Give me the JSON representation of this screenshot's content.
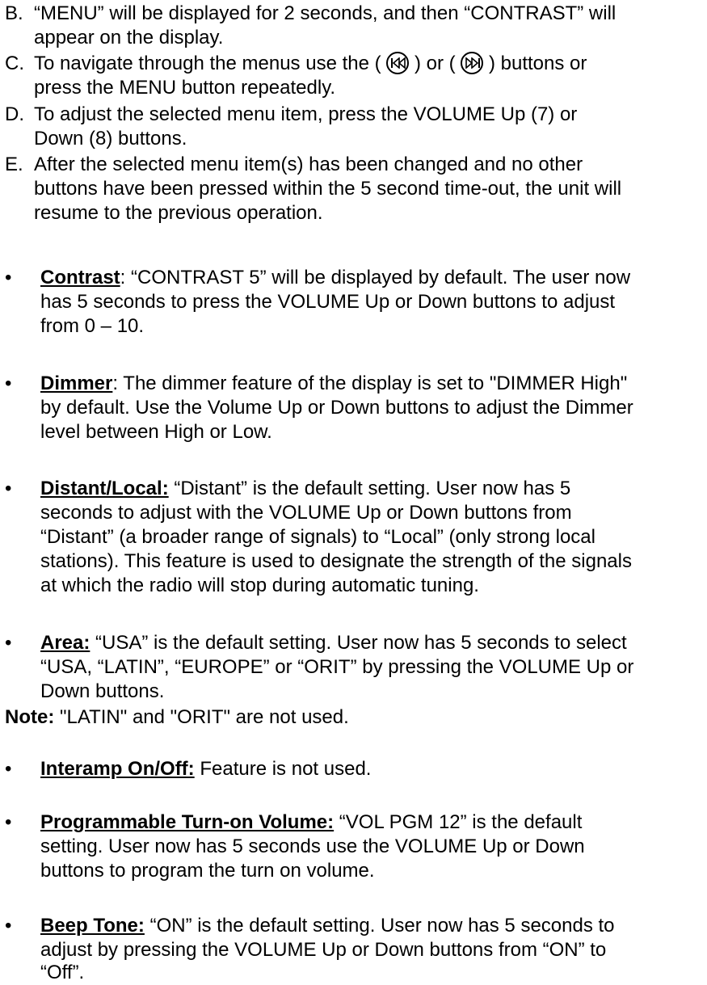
{
  "steps": [
    {
      "letter": "B.",
      "lines": [
        "“MENU” will be displayed for 2 seconds, and then “CONTRAST” will",
        "appear on the display."
      ]
    },
    {
      "letter": "C.",
      "line1_before": "To navigate through the menus use the (",
      "line1_mid": ") or (",
      "line1_after": ") buttons or",
      "lines_rest": [
        "press the MENU button repeatedly."
      ]
    },
    {
      "letter": "D.",
      "lines": [
        "To adjust the selected menu item, press the VOLUME Up (7) or",
        "Down (8) buttons."
      ]
    },
    {
      "letter": "E.",
      "lines": [
        "After the selected menu item(s) has been changed and no other",
        "buttons have been pressed within the 5 second time-out, the unit will",
        "resume to the previous operation."
      ]
    }
  ],
  "icons": {
    "prev": "skip-previous-icon",
    "next": "skip-next-icon"
  },
  "bullet_char": "•",
  "items": [
    {
      "heading": "Contrast",
      "sep": ":",
      "line1": " “CONTRAST 5” will be displayed by default. The user now",
      "lines": [
        "has 5 seconds to press the VOLUME Up or Down buttons to adjust",
        "from 0 – 10."
      ]
    },
    {
      "heading": "Dimmer",
      "sep": ":",
      "line1": " The dimmer feature of the display is set to \"DIMMER High\"",
      "lines": [
        "by default. Use the Volume Up or Down buttons to adjust the Dimmer",
        "level between High or Low."
      ]
    },
    {
      "heading": "Distant/Local:",
      "sep": "",
      "line1": " “Distant” is the default setting. User now has 5",
      "lines": [
        "seconds to adjust with the VOLUME Up or Down buttons from",
        "“Distant” (a broader range of signals) to “Local” (only strong local",
        "stations). This feature is used to designate the strength of the signals",
        "at which the radio will stop during automatic tuning."
      ]
    },
    {
      "heading": "Area:",
      "sep": "",
      "line1": " “USA” is the default setting. User now has 5 seconds to select",
      "lines": [
        "“USA, “LATIN”, “EUROPE” or “ORIT” by pressing the VOLUME Up or",
        "Down buttons."
      ]
    }
  ],
  "note": {
    "label": "Note:",
    "text": " \"LATIN\" and \"ORIT\" are not used."
  },
  "items2": [
    {
      "heading": "Interamp On/Off:",
      "line1": " Feature is not used.",
      "lines": []
    },
    {
      "heading": "Programmable Turn-on Volume:",
      "line1": " “VOL PGM 12” is the default",
      "lines": [
        "setting. User now has 5 seconds use the VOLUME Up or Down",
        "buttons to program the turn on volume."
      ]
    },
    {
      "heading": "Beep Tone:",
      "line1": " “ON” is the default setting. User now has 5 seconds to",
      "lines": [
        "adjust by pressing the VOLUME Up or Down buttons from “ON” to",
        "“Off”."
      ]
    }
  ]
}
